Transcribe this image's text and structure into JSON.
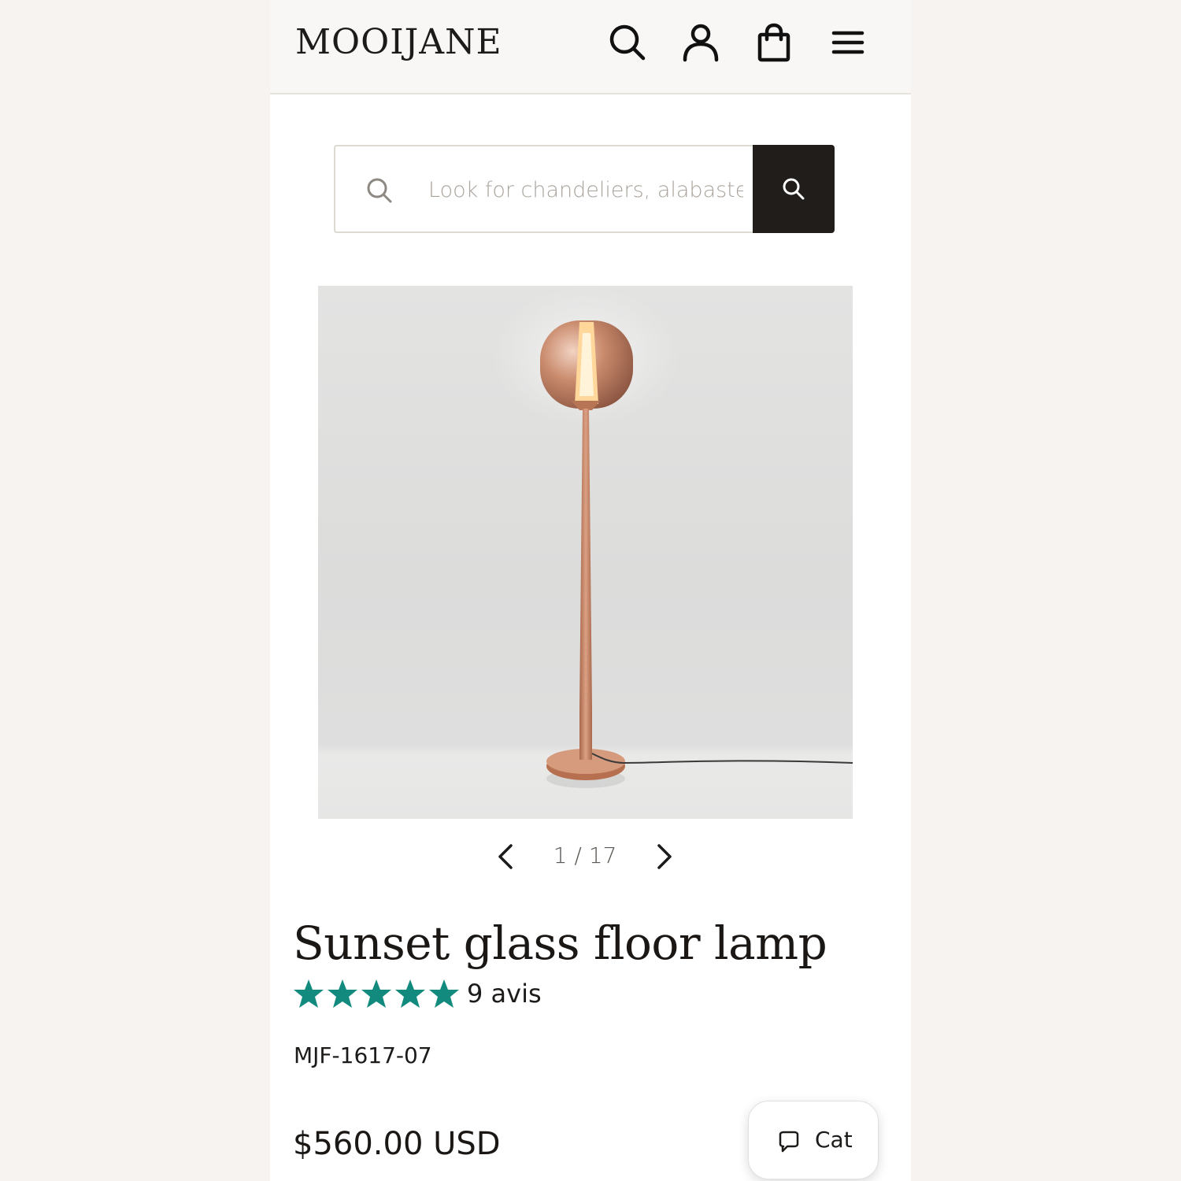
{
  "brand": {
    "logo_text": "MOOIJANE"
  },
  "header": {
    "icons": [
      "search-icon",
      "account-icon",
      "cart-bag-icon",
      "menu-icon"
    ]
  },
  "search": {
    "placeholder": "Look for chandeliers, alabaster",
    "value": ""
  },
  "gallery": {
    "current": "1 / 17",
    "image_alt": "Sunset glass floor lamp"
  },
  "product": {
    "title": "Sunset glass floor lamp",
    "rating_stars": 5,
    "review_count_label": "9 avis",
    "sku": "MJF-1617-07",
    "price": "$560.00 USD"
  },
  "chat": {
    "label": "Cat"
  },
  "colors": {
    "star": "#138a7e",
    "search_button": "#211d1b",
    "copper": "#c98a6c",
    "page_bg": "#f6f3f1"
  }
}
